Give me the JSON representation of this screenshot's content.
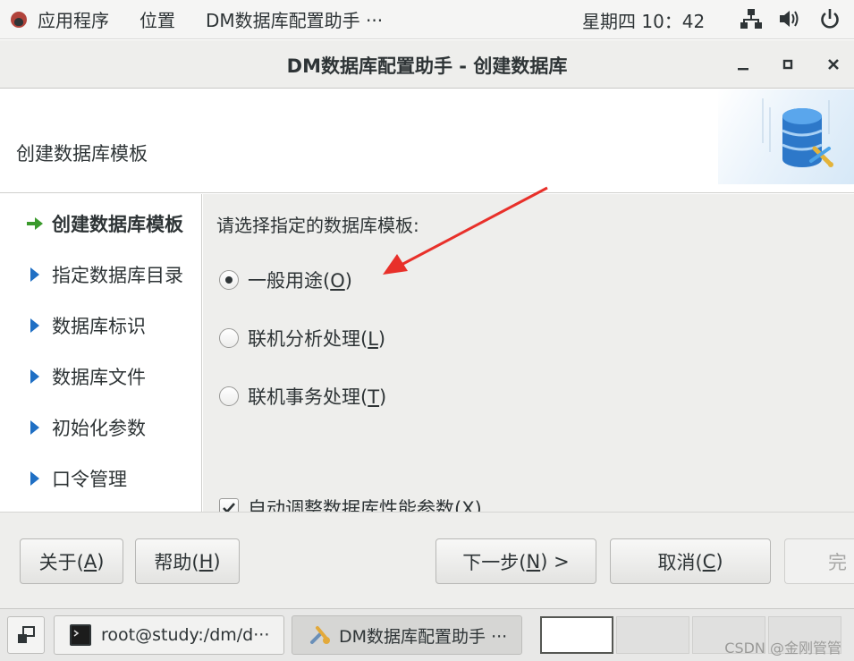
{
  "topbar": {
    "apps_menu": "应用程序",
    "places_menu": "位置",
    "active_app": "DM数据库配置助手 ···",
    "clock": "星期四 10：42"
  },
  "window": {
    "title": "DM数据库配置助手 - 创建数据库",
    "minimize": "_",
    "maximize": "□",
    "close": "×"
  },
  "header": {
    "title": "创建数据库模板"
  },
  "sidebar": {
    "items": [
      {
        "label": "创建数据库模板",
        "active": true
      },
      {
        "label": "指定数据库目录",
        "active": false
      },
      {
        "label": "数据库标识",
        "active": false
      },
      {
        "label": "数据库文件",
        "active": false
      },
      {
        "label": "初始化参数",
        "active": false
      },
      {
        "label": "口令管理",
        "active": false
      }
    ]
  },
  "content": {
    "prompt": "请选择指定的数据库模板:",
    "options": [
      {
        "label": "一般用途(",
        "mnemonic": "O",
        "suffix": ")",
        "checked": true
      },
      {
        "label": "联机分析处理(",
        "mnemonic": "L",
        "suffix": ")",
        "checked": false
      },
      {
        "label": "联机事务处理(",
        "mnemonic": "T",
        "suffix": ")",
        "checked": false
      }
    ],
    "auto_tune": {
      "label": "自动调整数据库性能参数(",
      "mnemonic": "X",
      "suffix": ")",
      "checked": true
    }
  },
  "buttons": {
    "about": {
      "label": "关于(",
      "mnemonic": "A",
      "suffix": ")"
    },
    "help": {
      "label": "帮助(",
      "mnemonic": "H",
      "suffix": ")"
    },
    "next": {
      "label": "下一步(",
      "mnemonic": "N",
      "suffix": ") >"
    },
    "cancel": {
      "label": "取消(",
      "mnemonic": "C",
      "suffix": ")"
    },
    "finish": {
      "label": "完"
    }
  },
  "taskbar": {
    "terminal": "root@study:/dm/d···",
    "dm_assistant": "DM数据库配置助手 ···",
    "watermark": "CSDN @金刚管管"
  },
  "colors": {
    "active_arrow": "#3a9a2c",
    "step_triangle": "#1f6fc4",
    "annotation_arrow": "#e8302a"
  }
}
